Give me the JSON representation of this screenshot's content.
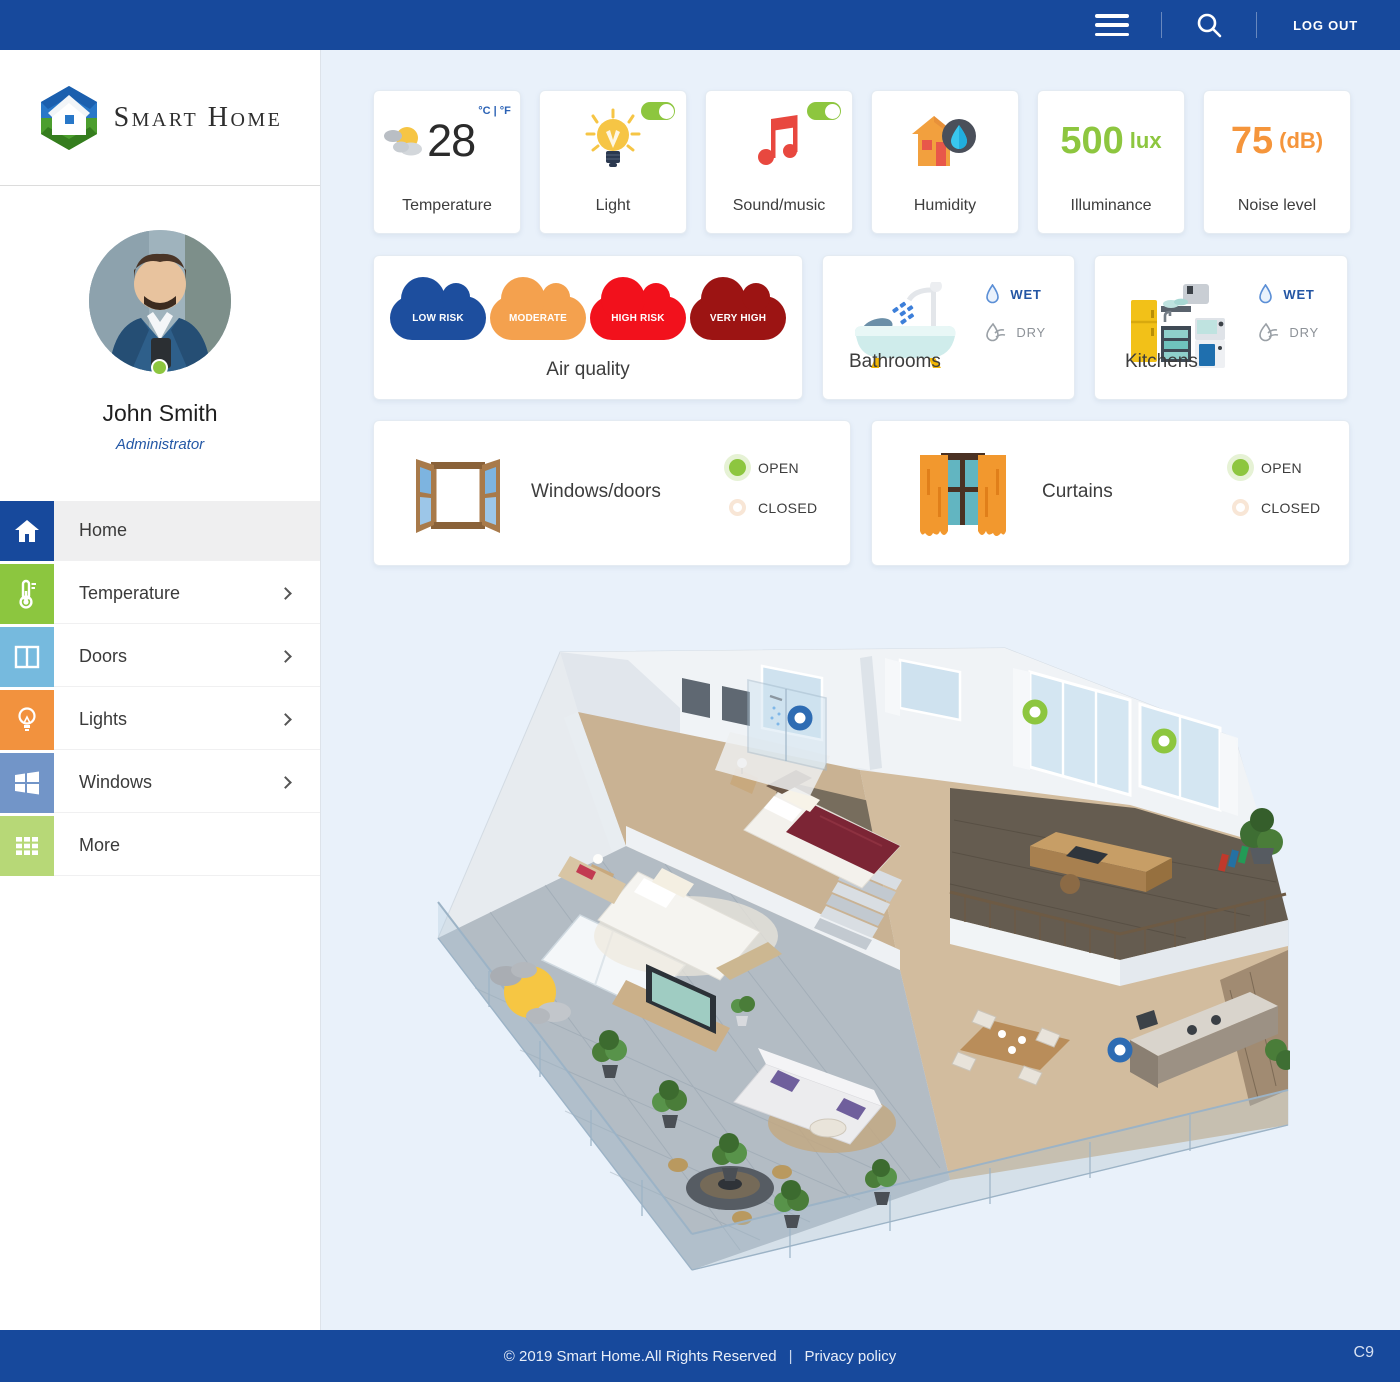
{
  "header": {
    "logout_label": "LOG OUT"
  },
  "brand": {
    "name": "Smart Home"
  },
  "user": {
    "name": "John Smith",
    "role": "Administrator",
    "status": "online"
  },
  "sidebar": {
    "nav": [
      {
        "label": "Home",
        "icon": "home-icon",
        "color": "#17499c",
        "active": true,
        "chevron": false
      },
      {
        "label": "Temperature",
        "icon": "thermometer-icon",
        "color": "#8cc63f",
        "active": false,
        "chevron": true
      },
      {
        "label": "Doors",
        "icon": "door-icon",
        "color": "#76bade",
        "active": false,
        "chevron": true
      },
      {
        "label": "Lights",
        "icon": "bulb-icon",
        "color": "#f2923e",
        "active": false,
        "chevron": true
      },
      {
        "label": "Windows",
        "icon": "windows-icon",
        "color": "#7295c8",
        "active": false,
        "chevron": true
      },
      {
        "label": "More",
        "icon": "grid-icon",
        "color": "#b7d877",
        "active": false,
        "chevron": false
      }
    ]
  },
  "metrics": {
    "temperature": {
      "label": "Temperature",
      "value": "28",
      "units": "°C | °F"
    },
    "light": {
      "label": "Light",
      "toggle_on": true
    },
    "sound": {
      "label": "Sound/music",
      "toggle_on": true
    },
    "humidity": {
      "label": "Humidity"
    },
    "illuminance": {
      "label": "Illuminance",
      "value": "500",
      "unit": "lux"
    },
    "noise": {
      "label": "Noise level",
      "value": "75",
      "unit": "(dB)"
    }
  },
  "air_quality": {
    "label": "Air quality",
    "levels": [
      {
        "label": "LOW RISK",
        "color": "#1d4e9e"
      },
      {
        "label": "MODERATE",
        "color": "#f4a14e"
      },
      {
        "label": "HIGH RISK",
        "color": "#f2111c"
      },
      {
        "label": "VERY HIGH",
        "color": "#9c1413"
      }
    ]
  },
  "rooms": {
    "bathrooms": {
      "label": "Bathrooms",
      "wet_label": "WET",
      "dry_label": "DRY",
      "state": "wet"
    },
    "kitchens": {
      "label": "Kitchens",
      "wet_label": "WET",
      "dry_label": "DRY",
      "state": "wet"
    }
  },
  "openables": {
    "windows_doors": {
      "label": "Windows/doors",
      "open_label": "OPEN",
      "closed_label": "CLOSED",
      "state": "open"
    },
    "curtains": {
      "label": "Curtains",
      "open_label": "OPEN",
      "closed_label": "CLOSED",
      "state": "open"
    }
  },
  "floorplan": {
    "sensors": [
      {
        "type": "bathroom-sensor",
        "color": "#2e6cb3"
      },
      {
        "type": "window-sensor",
        "color": "#8dc63f"
      },
      {
        "type": "window-sensor",
        "color": "#8dc63f"
      },
      {
        "type": "kitchen-sensor",
        "color": "#2e6cb3"
      }
    ],
    "weather_overlay": "sun-with-clouds"
  },
  "footer": {
    "copyright": "© 2019 Smart Home.All Rights Reserved",
    "separator": "|",
    "privacy": "Privacy policy",
    "version": "C9"
  },
  "colors": {
    "primary_blue": "#17499c",
    "accent_green": "#8dc63f",
    "accent_orange": "#f5953b",
    "link_blue": "#2458a6"
  }
}
